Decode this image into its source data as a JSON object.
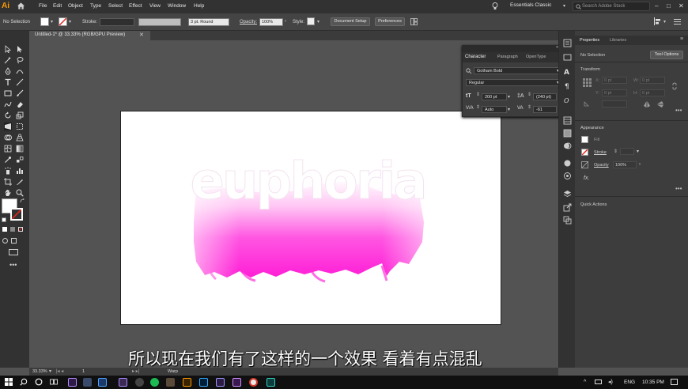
{
  "app": {
    "logo": "Ai",
    "menus": [
      "File",
      "Edit",
      "Object",
      "Type",
      "Select",
      "Effect",
      "View",
      "Window",
      "Help"
    ],
    "workspace": "Essentials Classic",
    "search_placeholder": "Search Adobe Stock"
  },
  "controlbar": {
    "selection": "No Selection",
    "stroke_label": "Stroke:",
    "brush": "3 pt. Round",
    "opacity_label": "Opacity:",
    "opacity": "100%",
    "style_label": "Style:",
    "doc_setup": "Document Setup",
    "preferences": "Preferences"
  },
  "document": {
    "tab_title": "Untitled-1* @ 33.33% (RGB/GPU Preview)"
  },
  "artwork": {
    "word": "euphoria",
    "colors": {
      "fill": "#ff2bd8",
      "light": "#ffb9f3"
    }
  },
  "character_panel": {
    "tabs": [
      "Character",
      "Paragraph",
      "OpenType"
    ],
    "font": "Gotham Bold",
    "style": "Regular",
    "size": "200 pt",
    "leading": "(240 pt)",
    "kerning": "Auto",
    "tracking": "-61"
  },
  "properties": {
    "tabs": [
      "Properties",
      "Libraries"
    ],
    "selection": "No Selection",
    "tool_options": "Tool Options",
    "transform": "Transform",
    "x": "X:",
    "y": "Y:",
    "w": "W:",
    "h": "H:",
    "x_val": "0 pt",
    "y_val": "0 pt",
    "w_val": "0 pt",
    "h_val": "0 pt",
    "appearance": "Appearance",
    "fill": "Fill",
    "stroke": "Stroke",
    "opacity": "Opacity",
    "opacity_val": "100%",
    "fx": "fx.",
    "quick_actions": "Quick Actions"
  },
  "status": {
    "zoom": "33.33%",
    "artboard": "1",
    "tool": "Warp"
  },
  "subtitle": "所以现在我们有了这样的一个效果 看着有点混乱",
  "taskbar": {
    "lang": "ENG",
    "time": "10:35 PM"
  }
}
